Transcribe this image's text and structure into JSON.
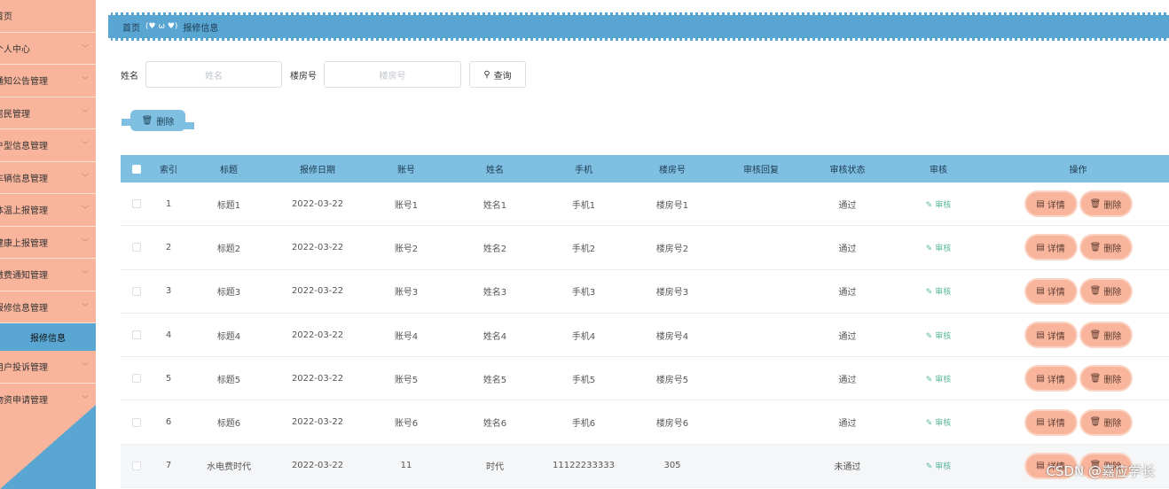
{
  "sidebar": {
    "items": [
      {
        "label": "首页",
        "chev": false
      },
      {
        "label": "个人中心",
        "chev": true
      },
      {
        "label": "通知公告管理",
        "chev": true
      },
      {
        "label": "居民管理",
        "chev": true
      },
      {
        "label": "户型信息管理",
        "chev": true
      },
      {
        "label": "车辆信息管理",
        "chev": true
      },
      {
        "label": "体温上报管理",
        "chev": true
      },
      {
        "label": "健康上报管理",
        "chev": true
      },
      {
        "label": "缴费通知管理",
        "chev": true
      },
      {
        "label": "报修信息管理",
        "chev": true
      }
    ],
    "active_sub": "报修信息",
    "items_after": [
      {
        "label": "用户投诉管理",
        "chev": true
      },
      {
        "label": "物资申请管理",
        "chev": true
      }
    ]
  },
  "breadcrumb": {
    "home": "首页",
    "sep": "(♥ ω ♥)",
    "current": "报修信息"
  },
  "search": {
    "name_label": "姓名",
    "name_placeholder": "姓名",
    "room_label": "楼房号",
    "room_placeholder": "楼房号",
    "query_label": "查询"
  },
  "toolbar": {
    "delete_label": "删除"
  },
  "table": {
    "headers": {
      "index": "索引",
      "title": "标题",
      "date": "报修日期",
      "account": "账号",
      "name": "姓名",
      "phone": "手机",
      "room": "楼房号",
      "reply": "审核回复",
      "status": "审核状态",
      "audit": "审核",
      "ops": "操作"
    },
    "audit_label": "审核",
    "detail_label": "详情",
    "delete_label": "删除",
    "rows": [
      {
        "index": "1",
        "title": "标题1",
        "date": "2022-03-22",
        "account": "账号1",
        "name": "姓名1",
        "phone": "手机1",
        "room": "楼房号1",
        "reply": "",
        "status": "通过"
      },
      {
        "index": "2",
        "title": "标题2",
        "date": "2022-03-22",
        "account": "账号2",
        "name": "姓名2",
        "phone": "手机2",
        "room": "楼房号2",
        "reply": "",
        "status": "通过"
      },
      {
        "index": "3",
        "title": "标题3",
        "date": "2022-03-22",
        "account": "账号3",
        "name": "姓名3",
        "phone": "手机3",
        "room": "楼房号3",
        "reply": "",
        "status": "通过"
      },
      {
        "index": "4",
        "title": "标题4",
        "date": "2022-03-22",
        "account": "账号4",
        "name": "姓名4",
        "phone": "手机4",
        "room": "楼房号4",
        "reply": "",
        "status": "通过"
      },
      {
        "index": "5",
        "title": "标题5",
        "date": "2022-03-22",
        "account": "账号5",
        "name": "姓名5",
        "phone": "手机5",
        "room": "楼房号5",
        "reply": "",
        "status": "通过"
      },
      {
        "index": "6",
        "title": "标题6",
        "date": "2022-03-22",
        "account": "账号6",
        "name": "姓名6",
        "phone": "手机6",
        "room": "楼房号6",
        "reply": "",
        "status": "通过"
      },
      {
        "index": "7",
        "title": "水电费时代",
        "date": "2022-03-22",
        "account": "11",
        "name": "时代",
        "phone": "11122233333",
        "room": "305",
        "reply": "",
        "status": "未通过"
      }
    ]
  },
  "watermark": "CSDN @嘉应学长"
}
